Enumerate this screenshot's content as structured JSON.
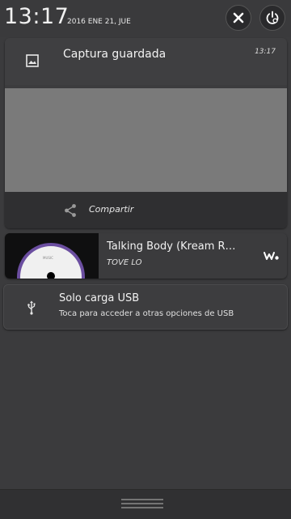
{
  "header": {
    "time": "13:17",
    "date": "2016 ENE 21, JUE"
  },
  "notifications": {
    "screenshot": {
      "title": "Captura guardada",
      "time": "13:17",
      "action_label": "Compartir"
    },
    "music": {
      "title": "Talking Body (Kream R…",
      "artist": "TOVE LO",
      "album_label": "MUSIC"
    },
    "usb": {
      "title": "Solo carga USB",
      "subtitle": "Toca para acceder a otras opciones de USB"
    }
  },
  "icons": {
    "close": "close-icon",
    "power": "power-settings-icon",
    "image": "image-icon",
    "share": "share-icon",
    "walkman": "walkman-icon",
    "usb": "usb-icon",
    "handle": "drag-handle-icon"
  },
  "colors": {
    "background": "#3b3b3d",
    "card": "#3c3c3e",
    "preview": "#7a7a7a",
    "album_ring": "#6b4ea0",
    "text": "#f2f2f2"
  }
}
